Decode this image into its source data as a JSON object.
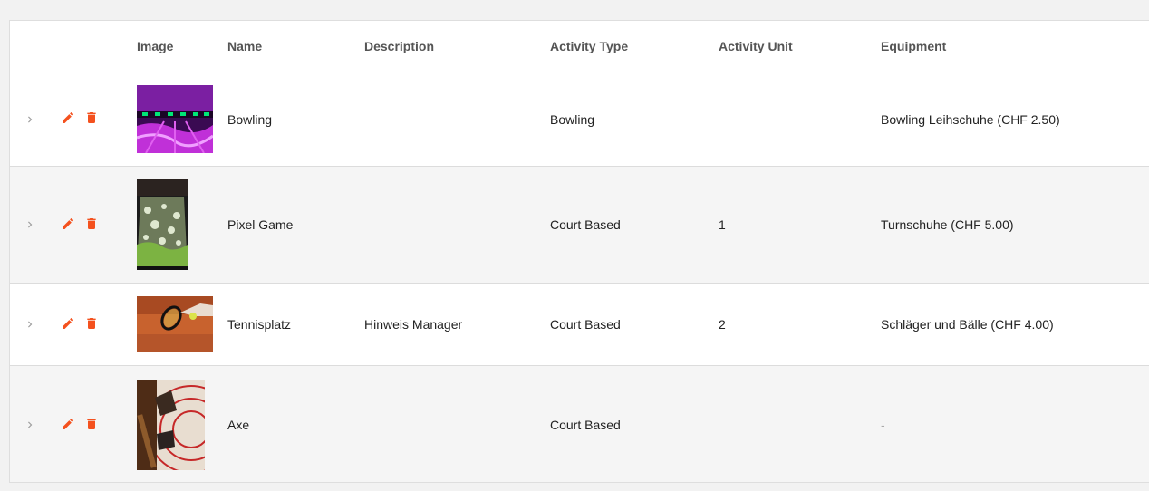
{
  "table": {
    "headers": {
      "image": "Image",
      "name": "Name",
      "description": "Description",
      "activity_type": "Activity Type",
      "activity_unit": "Activity Unit",
      "equipment": "Equipment"
    },
    "rows": [
      {
        "name": "Bowling",
        "description": "",
        "activity_type": "Bowling",
        "activity_unit": "",
        "equipment": "Bowling Leihschuhe (CHF 2.50)"
      },
      {
        "name": "Pixel Game",
        "description": "",
        "activity_type": "Court Based",
        "activity_unit": "1",
        "equipment": "Turnschuhe (CHF 5.00)"
      },
      {
        "name": "Tennisplatz",
        "description": "Hinweis Manager",
        "activity_type": "Court Based",
        "activity_unit": "2",
        "equipment": "Schläger und Bälle (CHF 4.00)"
      },
      {
        "name": "Axe",
        "description": "",
        "activity_type": "Court Based",
        "activity_unit": "",
        "equipment": "-"
      }
    ]
  },
  "colors": {
    "accent": "#f4511e",
    "chevron": "#9e9e9e"
  },
  "icons": {
    "expand": "chevron-right-icon",
    "edit": "pencil-icon",
    "delete": "trash-icon"
  }
}
